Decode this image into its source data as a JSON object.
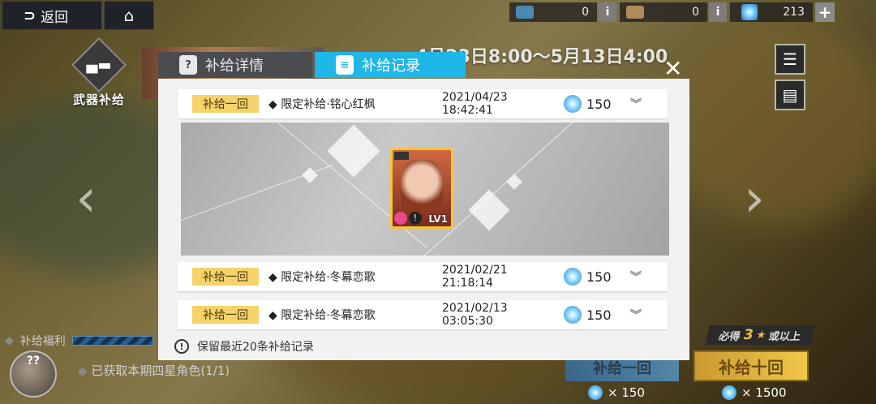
{
  "topbar": {
    "back_label": "返回",
    "back_glyph": "⊃",
    "home_glyph": "⌂",
    "resource1_count": "0",
    "resource2_count": "0",
    "gem_count": "213",
    "info_glyph": "i",
    "plus_glyph": "+"
  },
  "left": {
    "weapon_supply_label": "武器补给",
    "welfare_label": "补给福利",
    "obtained_text": "已获取本期四星角色(1/1)",
    "mascot_text": "??"
  },
  "banner": {
    "date_range": "4月23日8:00～5月13日4:00"
  },
  "tabs": {
    "details_label": "补给详情",
    "records_label": "补给记录",
    "details_icon": "?",
    "records_icon": "≡"
  },
  "modal": {
    "close_glyph": "✕",
    "records": [
      {
        "tag": "补给一回",
        "name": "◆ 限定补给·铭心红枫",
        "time": "2021/04/23 18:42:41",
        "amount": "150",
        "chevron": "︾"
      },
      {
        "tag": "补给一回",
        "name": "◆ 限定补给·冬幕恋歌",
        "time": "2021/02/21 21:18:14",
        "amount": "150",
        "chevron": "︾"
      },
      {
        "tag": "补给一回",
        "name": "◆ 限定补给·冬幕恋歌",
        "time": "2021/02/13 03:05:30",
        "amount": "150",
        "chevron": "︾"
      }
    ],
    "card_level": "LV1",
    "note_text": "保留最近20条补给记录",
    "note_icon": "!"
  },
  "bottom": {
    "guarantee_prefix": "必得",
    "guarantee_num": "3",
    "guarantee_star": "★",
    "guarantee_suffix": "或以上",
    "btn_one_label": "补给一回",
    "btn_ten_label": "补给十回",
    "cost_one": "× 150",
    "cost_ten": "× 1500"
  },
  "colors": {
    "accent_tab": "#1fb6e8",
    "tag_yellow": "#f6d36a",
    "card_border": "#f3c63a"
  }
}
